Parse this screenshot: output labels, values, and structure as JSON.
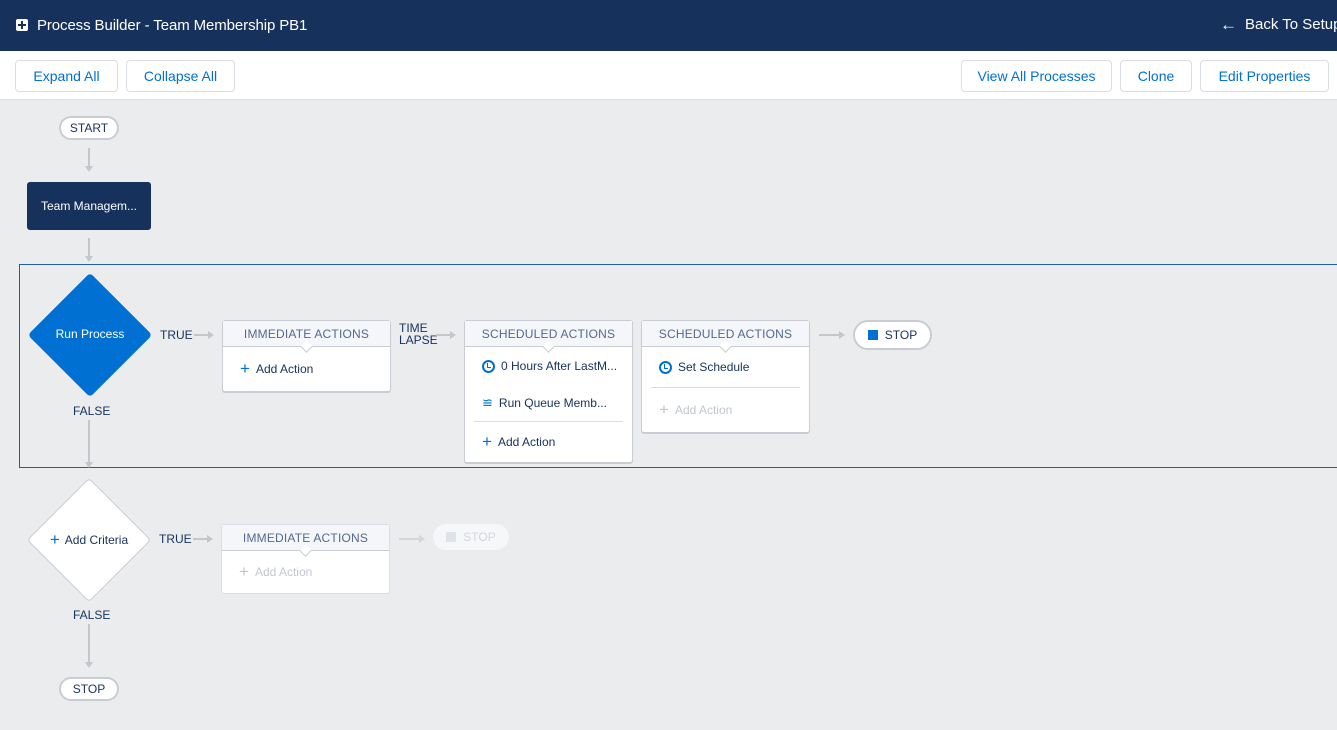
{
  "header": {
    "title": "Process Builder - Team Membership PB1",
    "back_label": "Back To Setup",
    "app_icon": "plus-box-icon",
    "back_icon": "arrow-left-icon"
  },
  "toolbar": {
    "expand_all": "Expand All",
    "collapse_all": "Collapse All",
    "view_all_processes": "View All Processes",
    "clone": "Clone",
    "edit_properties": "Edit Properties"
  },
  "flow": {
    "start_label": "START",
    "object_node": "Team Managem...",
    "criteria_1": {
      "label": "Run Process",
      "true_label": "TRUE",
      "false_label": "FALSE",
      "time_lapse_line1": "TIME",
      "time_lapse_line2": "LAPSE",
      "immediate_header": "IMMEDIATE ACTIONS",
      "immediate_add": "Add Action",
      "scheduled_1": {
        "header": "SCHEDULED ACTIONS",
        "schedule": "0 Hours After LastM...",
        "action": "Run Queue Memb...",
        "add": "Add Action"
      },
      "scheduled_2": {
        "header": "SCHEDULED ACTIONS",
        "schedule": "Set Schedule",
        "add": "Add Action"
      },
      "stop_label": "STOP"
    },
    "criteria_2": {
      "label": "Add Criteria",
      "true_label": "TRUE",
      "false_label": "FALSE",
      "immediate_header": "IMMEDIATE ACTIONS",
      "immediate_add": "Add Action",
      "stop_label": "STOP"
    },
    "end_stop_label": "STOP"
  },
  "colors": {
    "header_bg": "#16325c",
    "accent": "#0070d2",
    "canvas_bg": "#ebecee"
  }
}
